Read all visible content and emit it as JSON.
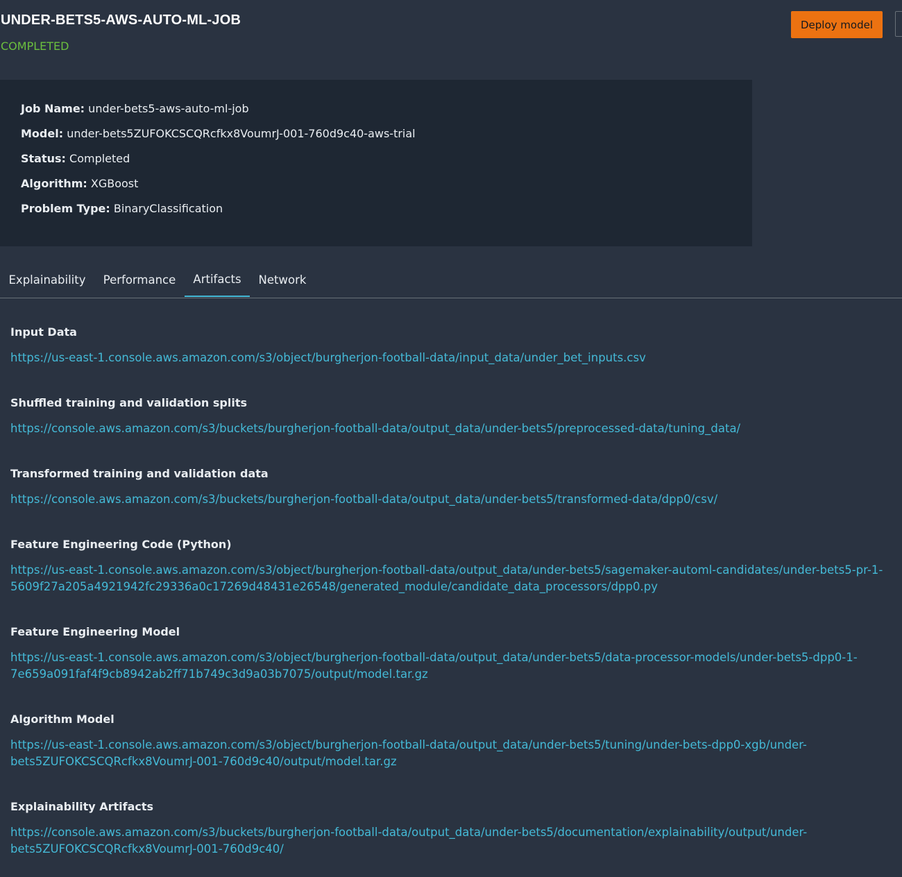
{
  "header": {
    "title": "UNDER-BETS5-AWS-AUTO-ML-JOB",
    "status": "COMPLETED",
    "deploy_label": "Deploy model"
  },
  "summary": {
    "rows": [
      {
        "key": "Job Name:",
        "value": "under-bets5-aws-auto-ml-job"
      },
      {
        "key": "Model:",
        "value": "under-bets5ZUFOKCSCQRcfkx8VoumrJ-001-760d9c40-aws-trial"
      },
      {
        "key": "Status:",
        "value": "Completed"
      },
      {
        "key": "Algorithm:",
        "value": "XGBoost"
      },
      {
        "key": "Problem Type:",
        "value": "BinaryClassification"
      }
    ]
  },
  "tabs": [
    {
      "label": "Explainability",
      "active": false
    },
    {
      "label": "Performance",
      "active": false
    },
    {
      "label": "Artifacts",
      "active": true
    },
    {
      "label": "Network",
      "active": false
    }
  ],
  "artifacts": [
    {
      "label": "Input Data",
      "link_lines": [
        "https://us-east-1.console.aws.amazon.com/s3/object/burgherjon-football-data/input_data/under_bet_inputs.csv"
      ]
    },
    {
      "label": "Shuffled training and validation splits",
      "link_lines": [
        "https://console.aws.amazon.com/s3/buckets/burgherjon-football-data/output_data/under-bets5/preprocessed-data/tuning_data/"
      ]
    },
    {
      "label": "Transformed training and validation data",
      "link_lines": [
        "https://console.aws.amazon.com/s3/buckets/burgherjon-football-data/output_data/under-bets5/transformed-data/dpp0/csv/"
      ]
    },
    {
      "label": "Feature Engineering Code (Python)",
      "link_lines": [
        "https://us-east-1.console.aws.amazon.com/s3/object/burgherjon-football-data/output_data/under-bets5/sagemaker-automl-candidates/under-bets5-pr-1-",
        "5609f27a205a4921942fc29336a0c17269d48431e26548/generated_module/candidate_data_processors/dpp0.py"
      ]
    },
    {
      "label": "Feature Engineering Model",
      "link_lines": [
        "https://us-east-1.console.aws.amazon.com/s3/object/burgherjon-football-data/output_data/under-bets5/data-processor-models/under-bets5-dpp0-1-",
        "7e659a091faf4f9cb8942ab2ff71b749c3d9a03b7075/output/model.tar.gz"
      ]
    },
    {
      "label": "Algorithm Model",
      "link_lines": [
        "https://us-east-1.console.aws.amazon.com/s3/object/burgherjon-football-data/output_data/under-bets5/tuning/under-bets-dpp0-xgb/under-",
        "bets5ZUFOKCSCQRcfkx8VoumrJ-001-760d9c40/output/model.tar.gz"
      ]
    },
    {
      "label": "Explainability Artifacts",
      "link_lines": [
        "https://console.aws.amazon.com/s3/buckets/burgherjon-football-data/output_data/under-bets5/documentation/explainability/output/under-",
        "bets5ZUFOKCSCQRcfkx8VoumrJ-001-760d9c40/"
      ]
    }
  ],
  "colors": {
    "background": "#2a3341",
    "summary_background": "#1e2733",
    "status_green": "#6bbf3e",
    "link": "#44b9d6",
    "primary_button": "#ec7211"
  }
}
